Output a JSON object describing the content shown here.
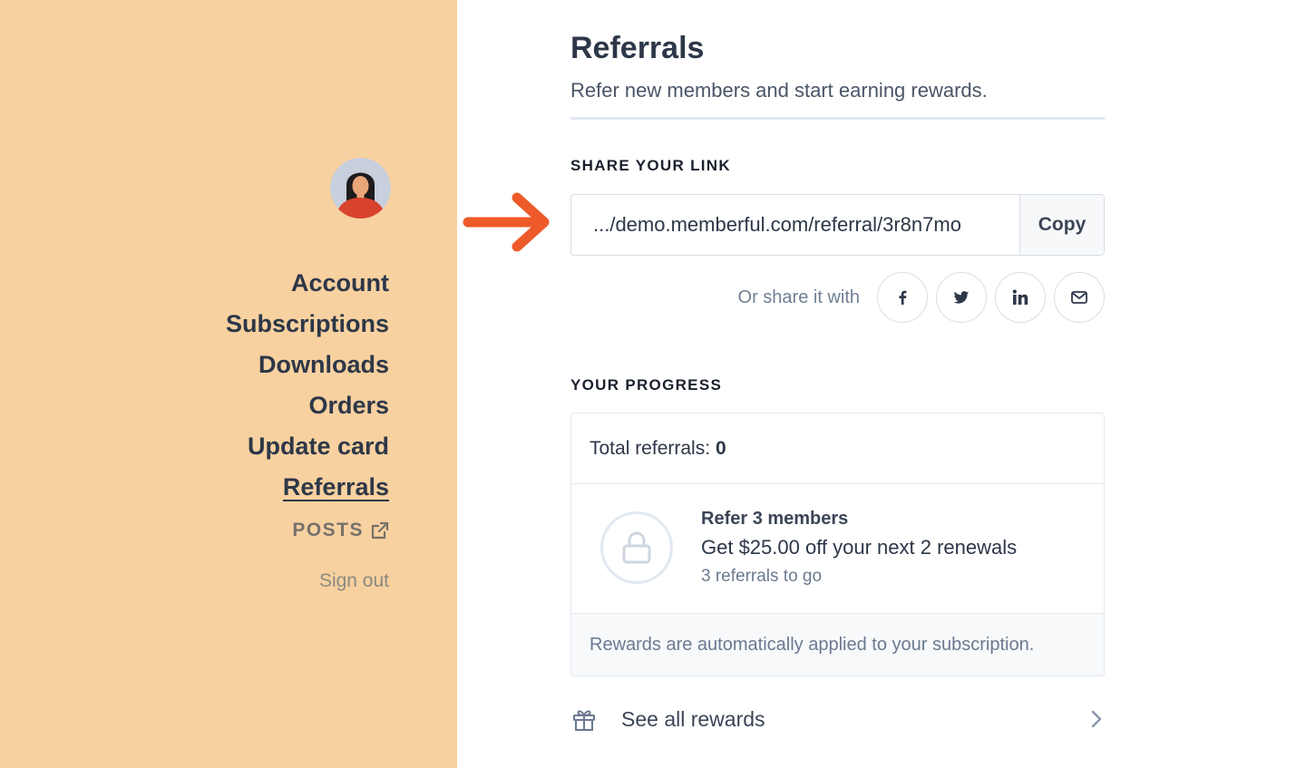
{
  "sidebar": {
    "nav_items": [
      "Account",
      "Subscriptions",
      "Downloads",
      "Orders",
      "Update card",
      "Referrals"
    ],
    "active_item": "Referrals",
    "posts_label": "POSTS",
    "sign_out_label": "Sign out",
    "background": "#f8d1a0"
  },
  "header": {
    "title": "Referrals",
    "subtitle": "Refer new members and start earning rewards."
  },
  "share": {
    "section_label": "SHARE YOUR LINK",
    "link_value": ".../demo.memberful.com/referral/3r8n7mo",
    "copy_label": "Copy",
    "share_with_label": "Or share it with",
    "social_icons": [
      "facebook-icon",
      "twitter-icon",
      "linkedin-icon",
      "email-icon"
    ]
  },
  "progress": {
    "section_label": "YOUR PROGRESS",
    "total_label": "Total referrals:",
    "total_value": "0",
    "reward_title": "Refer 3 members",
    "reward_description": "Get $25.00 off your next 2 renewals",
    "reward_progress": "3 referrals to go",
    "footer_note": "Rewards are automatically applied to your subscription."
  },
  "see_all_rewards": {
    "label": "See all rewards"
  },
  "colors": {
    "accent_arrow": "#ee5a2a",
    "text_dark": "#2d3748",
    "border": "#e2e8f0"
  }
}
